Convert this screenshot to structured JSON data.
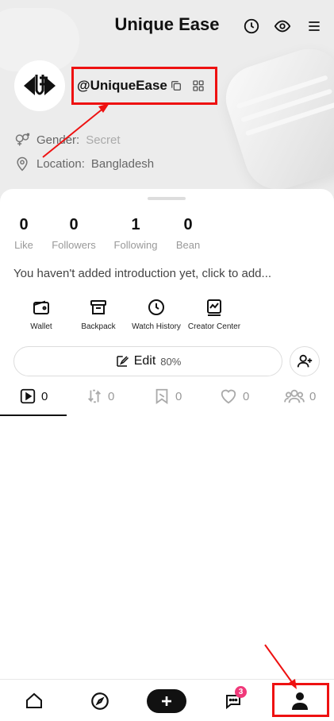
{
  "header": {
    "title": "Unique Ease"
  },
  "profile": {
    "username": "@UniqueEase",
    "gender_label": "Gender:",
    "gender_value": "Secret",
    "location_label": "Location:",
    "location_value": "Bangladesh"
  },
  "stats": [
    {
      "value": "0",
      "label": "Like"
    },
    {
      "value": "0",
      "label": "Followers"
    },
    {
      "value": "1",
      "label": "Following"
    },
    {
      "value": "0",
      "label": "Bean"
    }
  ],
  "intro": "You haven't added introduction yet, click to add...",
  "tools": [
    {
      "label": "Wallet",
      "icon": "wallet-icon"
    },
    {
      "label": "Backpack",
      "icon": "backpack-icon"
    },
    {
      "label": "Watch History",
      "icon": "clock-icon"
    },
    {
      "label": "Creator Center",
      "icon": "chart-icon"
    }
  ],
  "edit": {
    "label": "Edit",
    "percent": "80%"
  },
  "tabs": [
    {
      "count": "0",
      "icon": "video-icon"
    },
    {
      "count": "0",
      "icon": "repost-icon"
    },
    {
      "count": "0",
      "icon": "bookmark-icon"
    },
    {
      "count": "0",
      "icon": "heart-icon"
    },
    {
      "count": "0",
      "icon": "group-icon"
    }
  ],
  "bottom_nav": {
    "items": [
      "home-icon",
      "compass-icon",
      "plus-icon",
      "chat-icon",
      "profile-icon"
    ],
    "chat_badge": "3"
  },
  "colors": {
    "annotation": "#e11111",
    "badge": "#f0397a"
  }
}
